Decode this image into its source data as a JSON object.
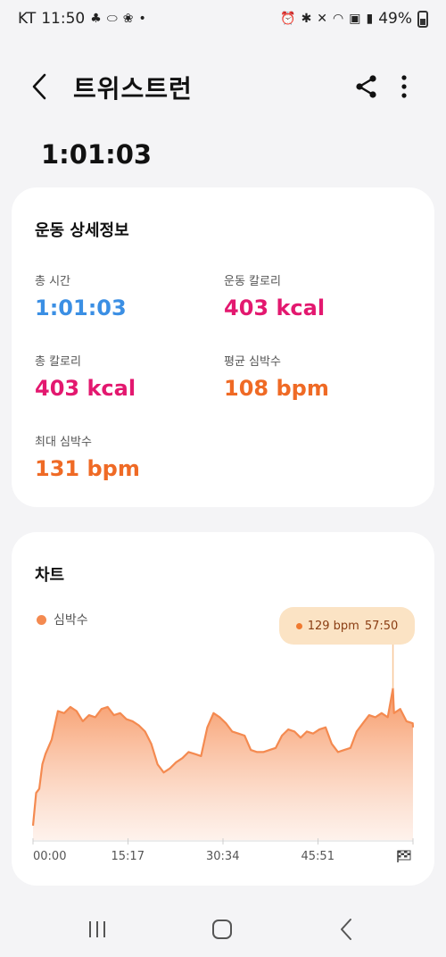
{
  "status_bar": {
    "carrier": "KT",
    "time": "11:50",
    "battery": "49%",
    "battery_level": 0.49
  },
  "app_bar": {
    "title": "트위스트런"
  },
  "workout": {
    "duration": "1:01:03"
  },
  "details": {
    "title": "운동 상세정보",
    "total_time_label": "총 시간",
    "total_time_value": "1:01:03",
    "workout_calories_label": "운동 칼로리",
    "workout_calories_value": "403 kcal",
    "total_calories_label": "총 칼로리",
    "total_calories_value": "403 kcal",
    "avg_hr_label": "평균 심박수",
    "avg_hr_value": "108 bpm",
    "max_hr_label": "최대 심박수",
    "max_hr_value": "131 bpm"
  },
  "chart_section": {
    "title": "차트",
    "legend": "심박수",
    "tooltip_value": "129 bpm",
    "tooltip_time": "57:50"
  },
  "colors": {
    "heart_rate": "#f48a50",
    "blue_value": "#3b8fe4",
    "calorie_value": "#e3186f",
    "hr_value": "#ef6a25"
  },
  "chart_data": {
    "type": "area",
    "series": [
      {
        "name": "심박수",
        "x": [
          0,
          0.5,
          1,
          1.5,
          2,
          3,
          4,
          5,
          6,
          7,
          8,
          9,
          10,
          11,
          12,
          13,
          14,
          15,
          16,
          17,
          18,
          19,
          20,
          21,
          22,
          23,
          24,
          25,
          26,
          27,
          28,
          29,
          30,
          31,
          32,
          33,
          34,
          35,
          36,
          37,
          38,
          39,
          40,
          41,
          42,
          43,
          44,
          45,
          46,
          47,
          48,
          49,
          50,
          51,
          52,
          53,
          54,
          55,
          56,
          57,
          57.83,
          58,
          59,
          60,
          61,
          61.05
        ],
        "values": [
          62,
          78,
          80,
          92,
          97,
          104,
          118,
          117,
          120,
          118,
          113,
          116,
          115,
          119,
          120,
          116,
          117,
          114,
          113,
          111,
          108,
          102,
          92,
          88,
          90,
          93,
          95,
          98,
          97,
          96,
          110,
          117,
          115,
          112,
          108,
          107,
          106,
          99,
          98,
          98,
          99,
          100,
          106,
          109,
          108,
          105,
          108,
          107,
          109,
          110,
          102,
          98,
          99,
          100,
          108,
          112,
          116,
          115,
          117,
          115,
          129,
          117,
          119,
          113,
          112,
          110
        ]
      }
    ],
    "x_tick_labels": [
      "00:00",
      "15:17",
      "30:34",
      "45:51"
    ],
    "xlim": [
      0,
      61.05
    ],
    "ylim": [
      55,
      140
    ],
    "xlabel": "",
    "ylabel": "",
    "grid": false,
    "legend_position": "top-left"
  }
}
